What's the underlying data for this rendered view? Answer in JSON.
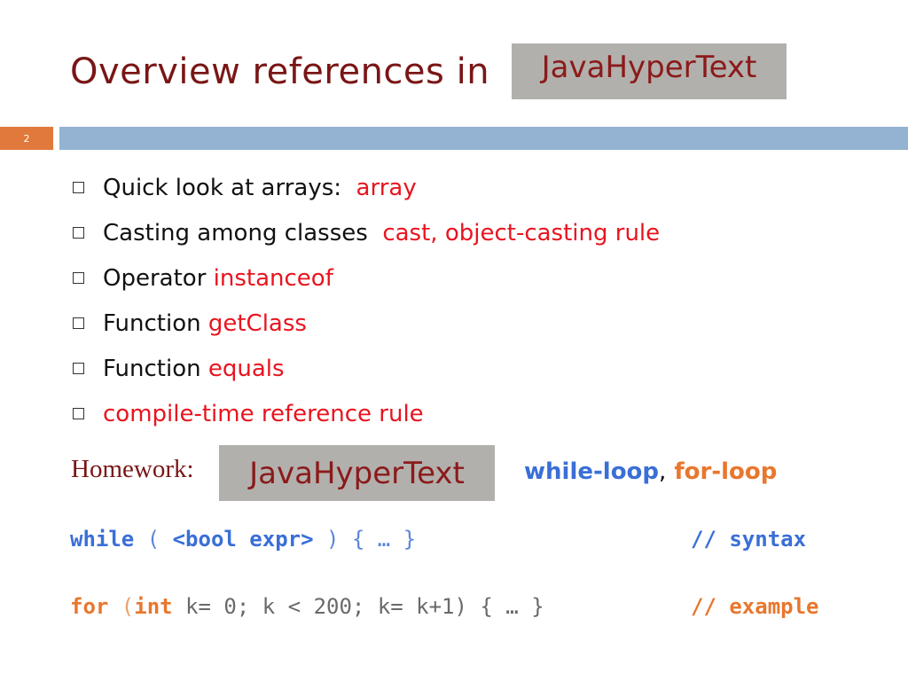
{
  "slide": {
    "title": "Overview references in",
    "javahypertext_label": "JavaHyperText",
    "slide_number": "2"
  },
  "bullets": [
    {
      "text": "Quick look at arrays:",
      "link": "array"
    },
    {
      "text": "Casting among classes",
      "link": "cast, object-casting rule"
    },
    {
      "text": "Operator",
      "link": "instanceof"
    },
    {
      "text": "Function",
      "link": "getClass"
    },
    {
      "text": "Function",
      "link": "equals"
    },
    {
      "text": "",
      "link": "compile-time reference rule"
    }
  ],
  "homework": {
    "label": "Homework:",
    "javahypertext_label": "JavaHyperText",
    "link1": "while-loop",
    "separator": ",",
    "link2": "for-loop"
  },
  "code": {
    "while_keyword": "while",
    "while_open": " ( ",
    "while_expr": "<bool expr>",
    "while_rest": " ) { … }",
    "while_comment": "// syntax",
    "for_keyword": "for",
    "for_open": " (",
    "for_int": "int",
    "for_rest": " k= 0; k < 200; k= k+1) { … }",
    "for_comment": "// example"
  },
  "colors": {
    "title": "#7a1616",
    "link_red": "#e8141f",
    "link_blue": "#3a6fd6",
    "link_orange": "#e8772e",
    "accent_bar": "#94b2d1",
    "number_box": "#e0793b"
  }
}
